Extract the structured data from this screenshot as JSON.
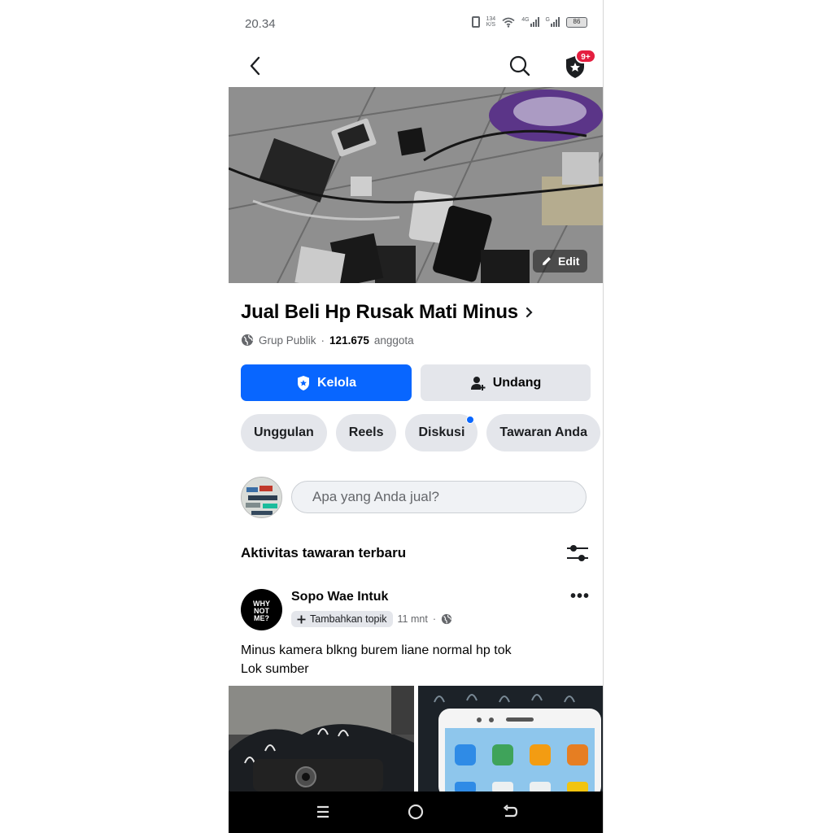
{
  "status_bar": {
    "time": "20.34",
    "net_speed_top": "134",
    "net_speed_bottom": "K/S",
    "net_type_1": "4G",
    "net_type_2": "G",
    "battery": "86"
  },
  "app_bar": {
    "notification_badge": "9+",
    "icons": [
      "back-arrow-icon",
      "search-icon",
      "admin-shield-icon"
    ]
  },
  "cover": {
    "edit_label": "Edit"
  },
  "group": {
    "name": "Jual Beli Hp Rusak Mati Minus",
    "privacy": "Grup Publik",
    "separator": "·",
    "member_count": "121.675",
    "member_label": "anggota"
  },
  "actions": {
    "manage_label": "Kelola",
    "invite_label": "Undang"
  },
  "tabs": [
    {
      "label": "Unggulan"
    },
    {
      "label": "Reels"
    },
    {
      "label": "Diskusi",
      "has_dot": true
    },
    {
      "label": "Tawaran Anda"
    }
  ],
  "composer": {
    "placeholder": "Apa yang Anda jual?"
  },
  "section": {
    "title": "Aktivitas tawaran terbaru"
  },
  "post": {
    "author": "Sopo Wae Intuk",
    "avatar_text": "WHY NOT ME?",
    "topic_chip": "Tambahkan topik",
    "time": "11 mnt",
    "dot": "·",
    "text_line1": "Minus kamera blkng burem liane normal hp tok",
    "text_line2": "Lok sumber"
  },
  "colors": {
    "primary": "#0866ff",
    "badge": "#e41e3f",
    "chip_bg": "#e4e6eb"
  }
}
